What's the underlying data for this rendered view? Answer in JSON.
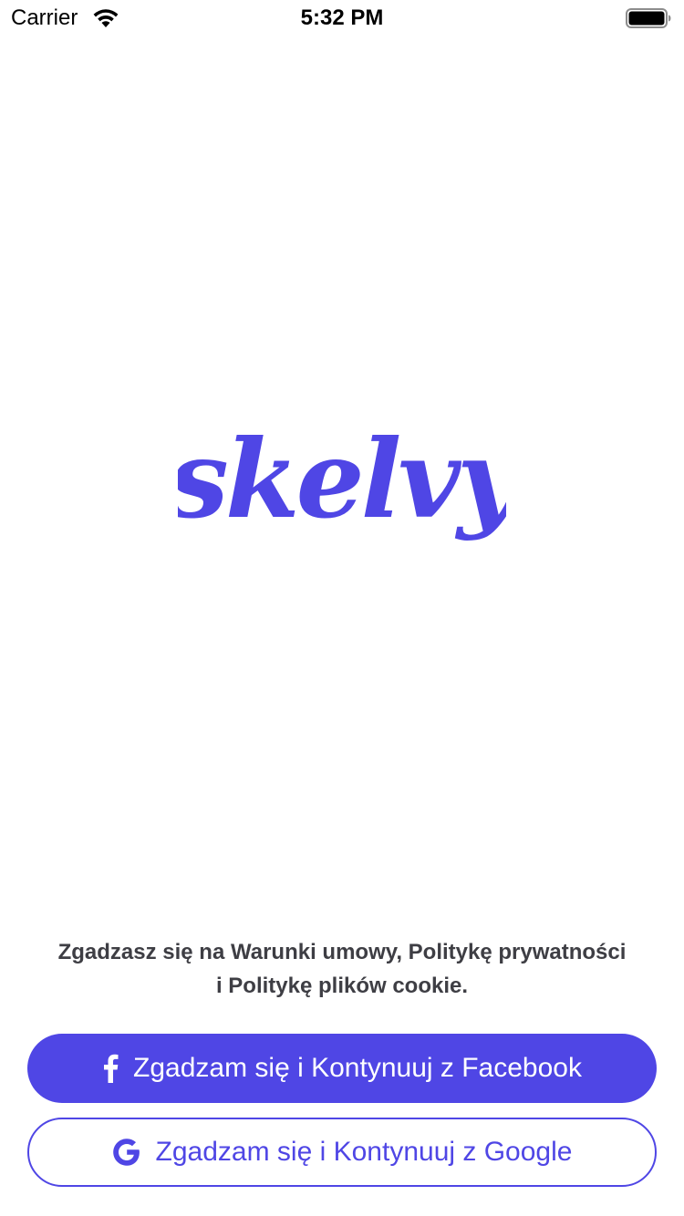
{
  "status_bar": {
    "carrier": "Carrier",
    "time": "5:32 PM",
    "wifi_icon": "wifi-icon",
    "battery_icon": "battery-icon"
  },
  "logo": {
    "text": "skelvy",
    "color": "#4f46e5"
  },
  "consent": {
    "text": "Zgadzasz się na Warunki umowy, Politykę prywatności i Politykę plików cookie."
  },
  "buttons": {
    "facebook": {
      "label": "Zgadzam się i Kontynuuj z Facebook",
      "icon": "facebook-icon",
      "background": "#4f46e5",
      "text_color": "#ffffff"
    },
    "google": {
      "label": "Zgadzam się i Kontynuuj z Google",
      "icon": "google-icon",
      "border_color": "#4f46e5",
      "text_color": "#4f46e5"
    }
  }
}
